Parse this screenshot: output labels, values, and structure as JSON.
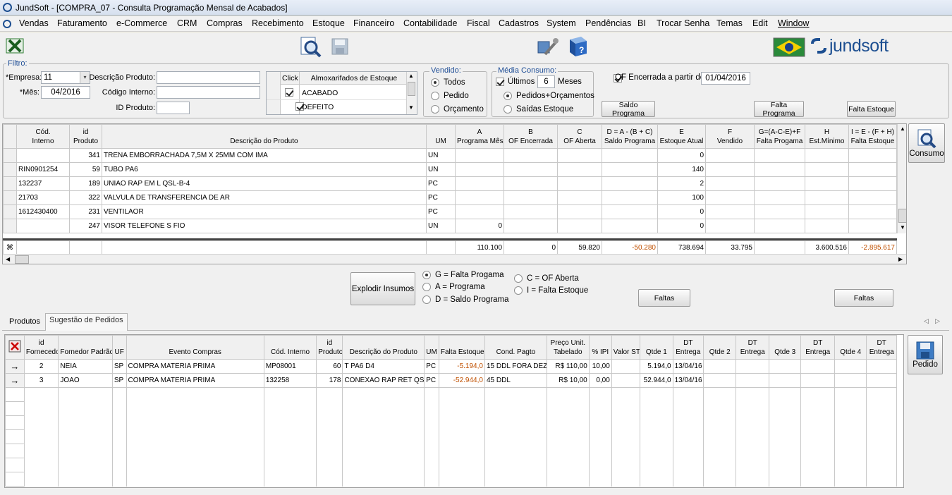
{
  "window": {
    "title": "JundSoft - [COMPRA_07 - Consulta Programação Mensal de Acabados]"
  },
  "menu": [
    "Vendas",
    "Faturamento",
    "e-Commerce",
    "CRM",
    "Compras",
    "Recebimento",
    "Estoque",
    "Financeiro",
    "Contabilidade",
    "Fiscal",
    "Cadastros",
    "System",
    "Pendências",
    "BI",
    "Trocar Senha",
    "Temas",
    "Edit",
    "Window"
  ],
  "toolbar": {
    "brand": "jundsoft"
  },
  "filtro": {
    "legend": "Filtro:",
    "empresa_label": "*Empresa:",
    "empresa_value": "11",
    "mes_label": "*Mês:",
    "mes_value": "04/2016",
    "descricao_label": "Descrição Produto:",
    "descricao_value": "",
    "codigo_label": "Código Interno:",
    "codigo_value": "",
    "idproduto_label": "ID Produto:",
    "idproduto_value": "",
    "almox": {
      "col_click": "Click",
      "col_name": "Almoxarifados de Estoque",
      "rows": [
        {
          "checked": true,
          "name": "ACABADO"
        },
        {
          "checked": true,
          "name": "DEFEITO"
        }
      ]
    },
    "vendido": {
      "legend": "Vendido:",
      "options": [
        "Todos",
        "Pedido",
        "Orçamento"
      ],
      "selected": 0
    },
    "media": {
      "legend": "Média Consumo:",
      "ultimos_label": "Últimos",
      "ultimos_checked": true,
      "ultimos_value": "6",
      "meses_label": "Meses",
      "options": [
        "Pedidos+Orçamentos",
        "Saídas Estoque"
      ],
      "selected": 0
    },
    "of_encerrada": {
      "checked": true,
      "label": "OF Encerrada a partir de:",
      "value": "01/04/2016"
    },
    "buttons": {
      "saldo_programa": "Saldo Programa",
      "falta_programa": "Falta Programa",
      "falta_estoque": "Falta Estoque"
    }
  },
  "grid1": {
    "headers": [
      [
        "Cód.",
        "Interno"
      ],
      [
        "id",
        "Produto"
      ],
      [
        "",
        "Descrição do Produto"
      ],
      [
        "",
        "UM"
      ],
      [
        "A",
        "Programa Mês"
      ],
      [
        "B",
        "OF Encerrada"
      ],
      [
        "C",
        "OF Aberta"
      ],
      [
        "D = A - (B + C)",
        "Saldo Programa"
      ],
      [
        "E",
        "Estoque Atual"
      ],
      [
        "F",
        "Vendido"
      ],
      [
        "G=(A-C-E)+F",
        "Falta Progama"
      ],
      [
        "H",
        "Est.Mínimo"
      ],
      [
        "I = E - (F + H)",
        "Falta Estoque"
      ]
    ],
    "rows": [
      [
        "",
        "341",
        "TRENA EMBORRACHADA 7,5M X 25MM COM IMA",
        "UN",
        "",
        "",
        "",
        "",
        "0",
        "",
        "",
        "",
        ""
      ],
      [
        "RIN0901254",
        "59",
        "TUBO PA6",
        "UN",
        "",
        "",
        "",
        "",
        "140",
        "",
        "",
        "",
        ""
      ],
      [
        "132237",
        "189",
        "UNIAO RAP EM L QSL-B-4",
        "PC",
        "",
        "",
        "",
        "",
        "2",
        "",
        "",
        "",
        ""
      ],
      [
        "21703",
        "322",
        "VALVULA DE TRANSFERENCIA DE AR",
        "PC",
        "",
        "",
        "",
        "",
        "100",
        "",
        "",
        "",
        ""
      ],
      [
        "1612430400",
        "231",
        "VENTILAOR",
        "PC",
        "",
        "",
        "",
        "",
        "0",
        "",
        "",
        "",
        ""
      ],
      [
        "",
        "247",
        "VISOR TELEFONE S FIO",
        "UN",
        "0",
        "",
        "",
        "",
        "0",
        "",
        "",
        "",
        ""
      ]
    ],
    "totals": [
      "",
      "",
      "",
      "",
      "110.100",
      "0",
      "59.820",
      "-50.280",
      "738.694",
      "33.795",
      "",
      "3.600.516",
      "-2.895.617"
    ]
  },
  "consumo_button": "Consumo",
  "explodir": {
    "button": "Explodir Insumos",
    "options_left": [
      "G = Falta Progama",
      "A = Programa",
      "D = Saldo Programa"
    ],
    "options_right": [
      "C = OF Aberta",
      "I = Falta Estoque"
    ],
    "selected": "G = Falta Progama",
    "faltas1": "Faltas",
    "faltas2": "Faltas"
  },
  "tabs": [
    "Produtos",
    "Sugestão de Pedidos"
  ],
  "active_tab": 1,
  "grid2": {
    "headers": [
      [
        "id",
        "Fornecedor"
      ],
      [
        "",
        "Fornedor Padrão"
      ],
      [
        "",
        "UF"
      ],
      [
        "",
        "Evento Compras"
      ],
      [
        "",
        "Cód. Interno"
      ],
      [
        "id",
        "Produto"
      ],
      [
        "",
        "Descrição do Produto"
      ],
      [
        "",
        "UM"
      ],
      [
        "",
        "Falta Estoque"
      ],
      [
        "",
        "Cond. Pagto"
      ],
      [
        "Preço Unit.",
        "Tabelado"
      ],
      [
        "",
        "% IPI"
      ],
      [
        "",
        "Valor ST"
      ],
      [
        "",
        "Qtde 1"
      ],
      [
        "DT",
        "Entrega"
      ],
      [
        "",
        "Qtde 2"
      ],
      [
        "DT",
        "Entrega"
      ],
      [
        "",
        "Qtde 3"
      ],
      [
        "DT",
        "Entrega"
      ],
      [
        "",
        "Qtde 4"
      ],
      [
        "DT",
        "Entrega"
      ]
    ],
    "rows": [
      [
        "2",
        "NEIA",
        "SP",
        "COMPRA MATERIA PRIMA",
        "MP08001",
        "60",
        "T PA6 D4",
        "PC",
        "-5.194,0",
        "15 DDL FORA DEZ",
        "R$ 110,00",
        "10,00",
        "",
        "5.194,0",
        "13/04/16",
        "",
        "",
        "",
        "",
        "",
        ""
      ],
      [
        "3",
        "JOAO",
        "SP",
        "COMPRA MATERIA PRIMA",
        "132258",
        "178",
        "CONEXAO RAP RET QS",
        "PC",
        "-52.944,0",
        "45 DDL",
        "R$ 10,00",
        "0,00",
        "",
        "52.944,0",
        "13/04/16",
        "",
        "",
        "",
        "",
        "",
        ""
      ]
    ]
  },
  "pedido_button": "Pedido"
}
